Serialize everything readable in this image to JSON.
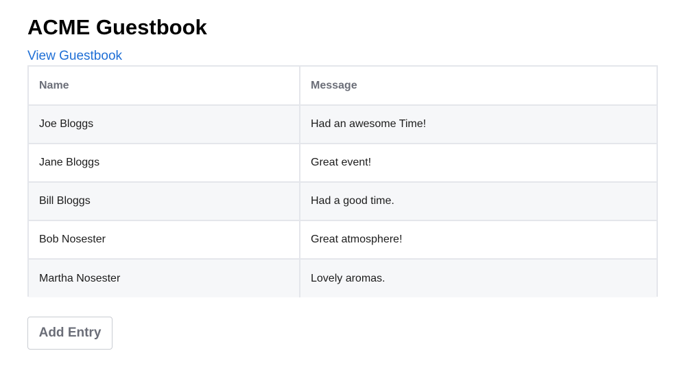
{
  "page": {
    "title": "ACME Guestbook",
    "nav_link": "View Guestbook"
  },
  "guestbook_table": {
    "headers": {
      "name": "Name",
      "message": "Message"
    },
    "rows": [
      {
        "name": "Joe Bloggs",
        "message": "Had an awesome Time!"
      },
      {
        "name": "Jane Bloggs",
        "message": "Great event!"
      },
      {
        "name": "Bill Bloggs",
        "message": "Had a good time."
      },
      {
        "name": "Bob Nosester",
        "message": "Great atmosphere!"
      },
      {
        "name": "Martha Nosester",
        "message": "Lovely aromas."
      }
    ]
  },
  "actions": {
    "add_entry_label": "Add Entry"
  },
  "colors": {
    "link": "#1f6fd6",
    "header_text": "#6b6e78",
    "stripe": "#f6f7f9",
    "border": "#e4e6eb"
  }
}
